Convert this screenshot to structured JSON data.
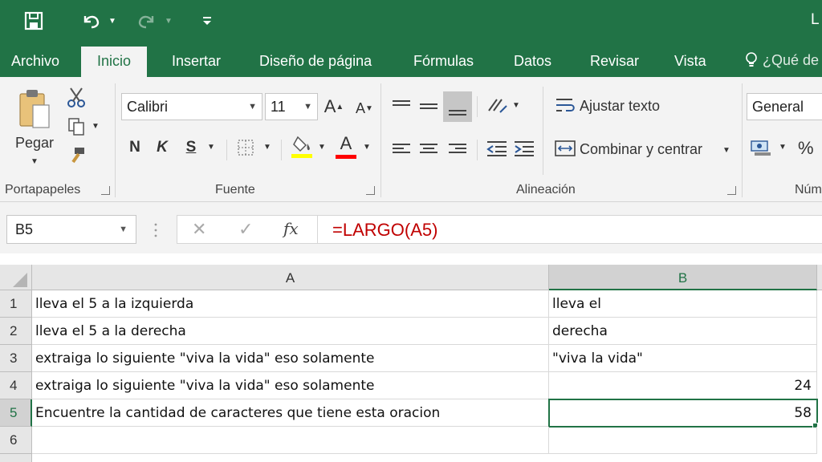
{
  "quick_access": {
    "save": "save",
    "undo": "undo",
    "redo": "redo",
    "customize": "customize"
  },
  "title_fragment": "L",
  "tabs": [
    {
      "label": "Archivo"
    },
    {
      "label": "Inicio"
    },
    {
      "label": "Insertar"
    },
    {
      "label": "Diseño de página"
    },
    {
      "label": "Fórmulas"
    },
    {
      "label": "Datos"
    },
    {
      "label": "Revisar"
    },
    {
      "label": "Vista"
    },
    {
      "label": "¿Qué de"
    }
  ],
  "ribbon": {
    "clipboard": {
      "paste_label": "Pegar",
      "group_label": "Portapapeles"
    },
    "font": {
      "font_name": "Calibri",
      "font_size": "11",
      "grow": "A",
      "shrink": "A",
      "bold": "N",
      "italic": "K",
      "underline": "S",
      "font_color_letter": "A",
      "group_label": "Fuente",
      "highlight_color": "#ffff00",
      "font_color": "#ff0000"
    },
    "alignment": {
      "wrap_text": "Ajustar texto",
      "merge_center": "Combinar y centrar",
      "group_label": "Alineación"
    },
    "number": {
      "format": "General",
      "percent": "%",
      "group_label": "Núm"
    }
  },
  "formula_bar": {
    "name_box": "B5",
    "cancel": "✕",
    "enter": "✓",
    "fx": "fx",
    "formula": "=LARGO(A5)"
  },
  "sheet": {
    "columns": [
      "A",
      "B"
    ],
    "rows": [
      {
        "num": "1",
        "a": "lleva el 5 a la izquierda",
        "b": "lleva el"
      },
      {
        "num": "2",
        "a": "lleva el 5 a la derecha",
        "b": "derecha"
      },
      {
        "num": "3",
        "a": "extraiga lo siguiente \"viva la vida\" eso solamente",
        "b": "\"viva la vida\""
      },
      {
        "num": "4",
        "a": "extraiga lo siguiente \"viva la vida\" eso solamente",
        "b": "24"
      },
      {
        "num": "5",
        "a": "Encuentre la cantidad de caracteres que tiene esta oracion",
        "b": "58"
      },
      {
        "num": "6",
        "a": "",
        "b": ""
      }
    ]
  },
  "colors": {
    "excel_green": "#217346",
    "formula_text": "#c00000"
  }
}
